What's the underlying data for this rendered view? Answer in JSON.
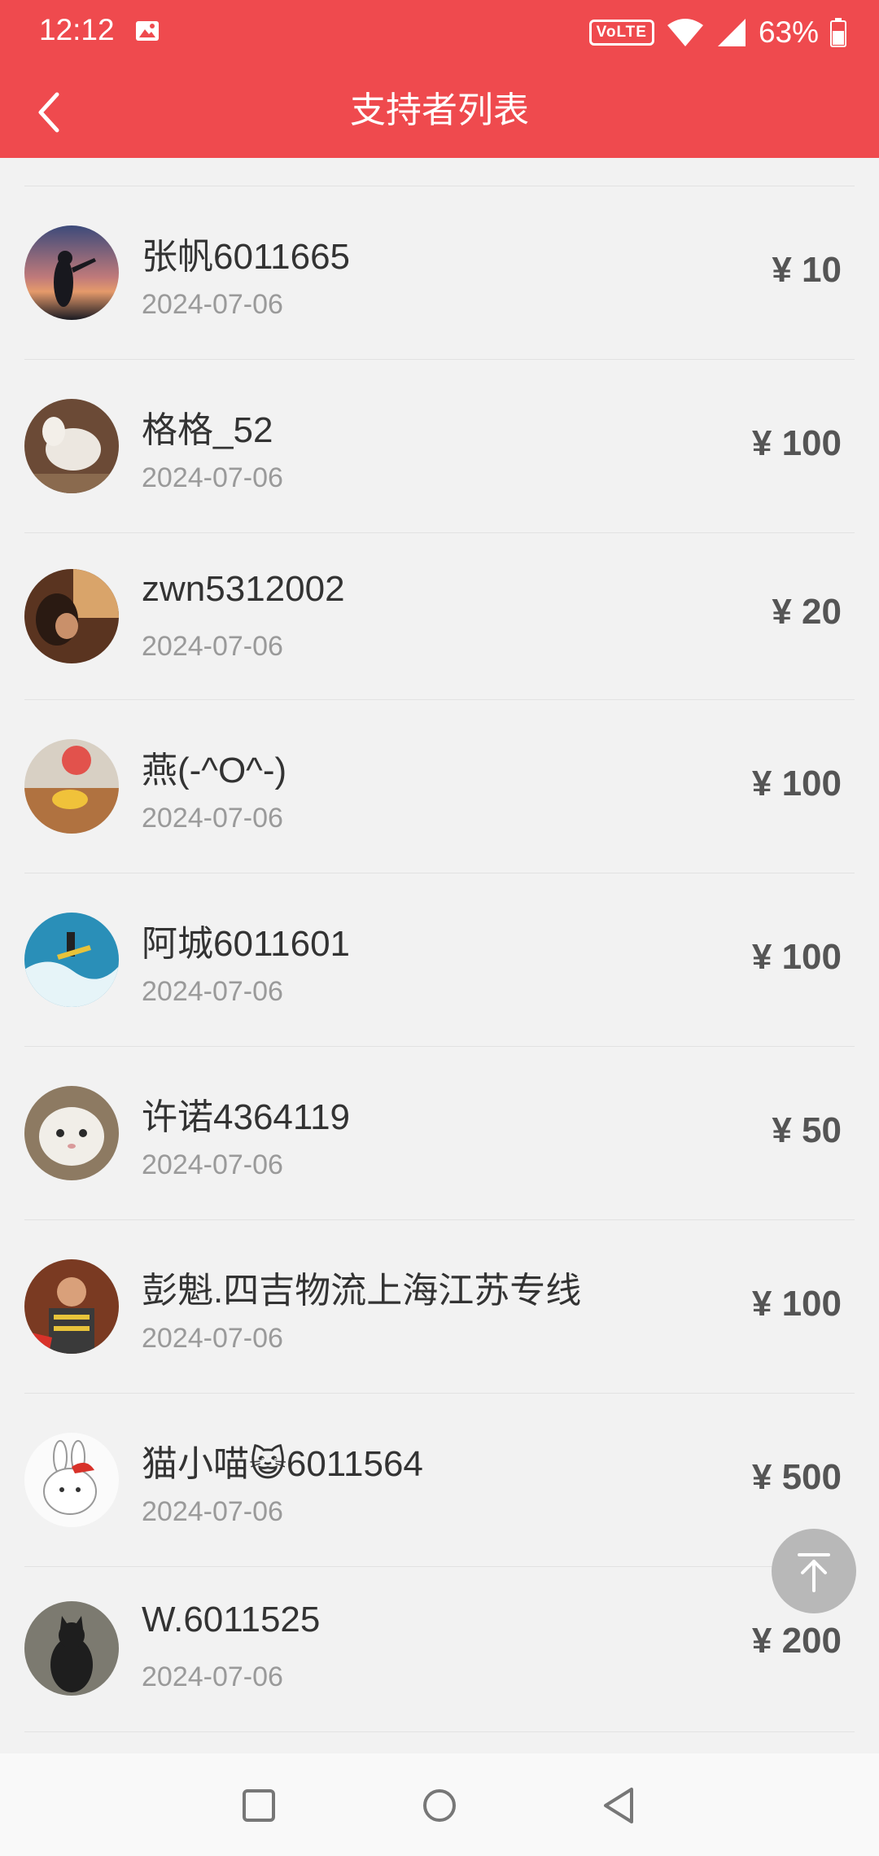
{
  "status_bar": {
    "time": "12:12",
    "network_badge": "VoLTE",
    "battery": "63%",
    "icons": [
      "image-icon",
      "wifi-icon",
      "signal-icon",
      "battery-icon"
    ]
  },
  "header": {
    "title": "支持者列表",
    "background": "#ef4a4e",
    "back_icon": "chevron-left-icon"
  },
  "supporters": [
    {
      "name": "张帆6011665",
      "date": "2024-07-06",
      "amount": "¥ 10"
    },
    {
      "name": "格格_52",
      "date": "2024-07-06",
      "amount": "¥ 100"
    },
    {
      "name": "zwn5312002",
      "date": "2024-07-06",
      "amount": "¥ 20"
    },
    {
      "name": "燕(-^O^-)",
      "date": "2024-07-06",
      "amount": "¥ 100"
    },
    {
      "name": "阿城6011601",
      "date": "2024-07-06",
      "amount": "¥ 100"
    },
    {
      "name": "许诺4364119",
      "date": "2024-07-06",
      "amount": "¥ 50"
    },
    {
      "name": "彭魁.四吉物流上海江苏专线",
      "date": "2024-07-06",
      "amount": "¥ 100"
    },
    {
      "name": "猫小喵😺6011564",
      "date": "2024-07-06",
      "amount": "¥ 500"
    },
    {
      "name": "W.6011525",
      "date": "2024-07-06",
      "amount": "¥ 200"
    }
  ],
  "floating": {
    "icon": "arrow-to-top-icon"
  },
  "nav_bar": {
    "icons": [
      "square-recents-icon",
      "circle-home-icon",
      "triangle-back-icon"
    ]
  }
}
